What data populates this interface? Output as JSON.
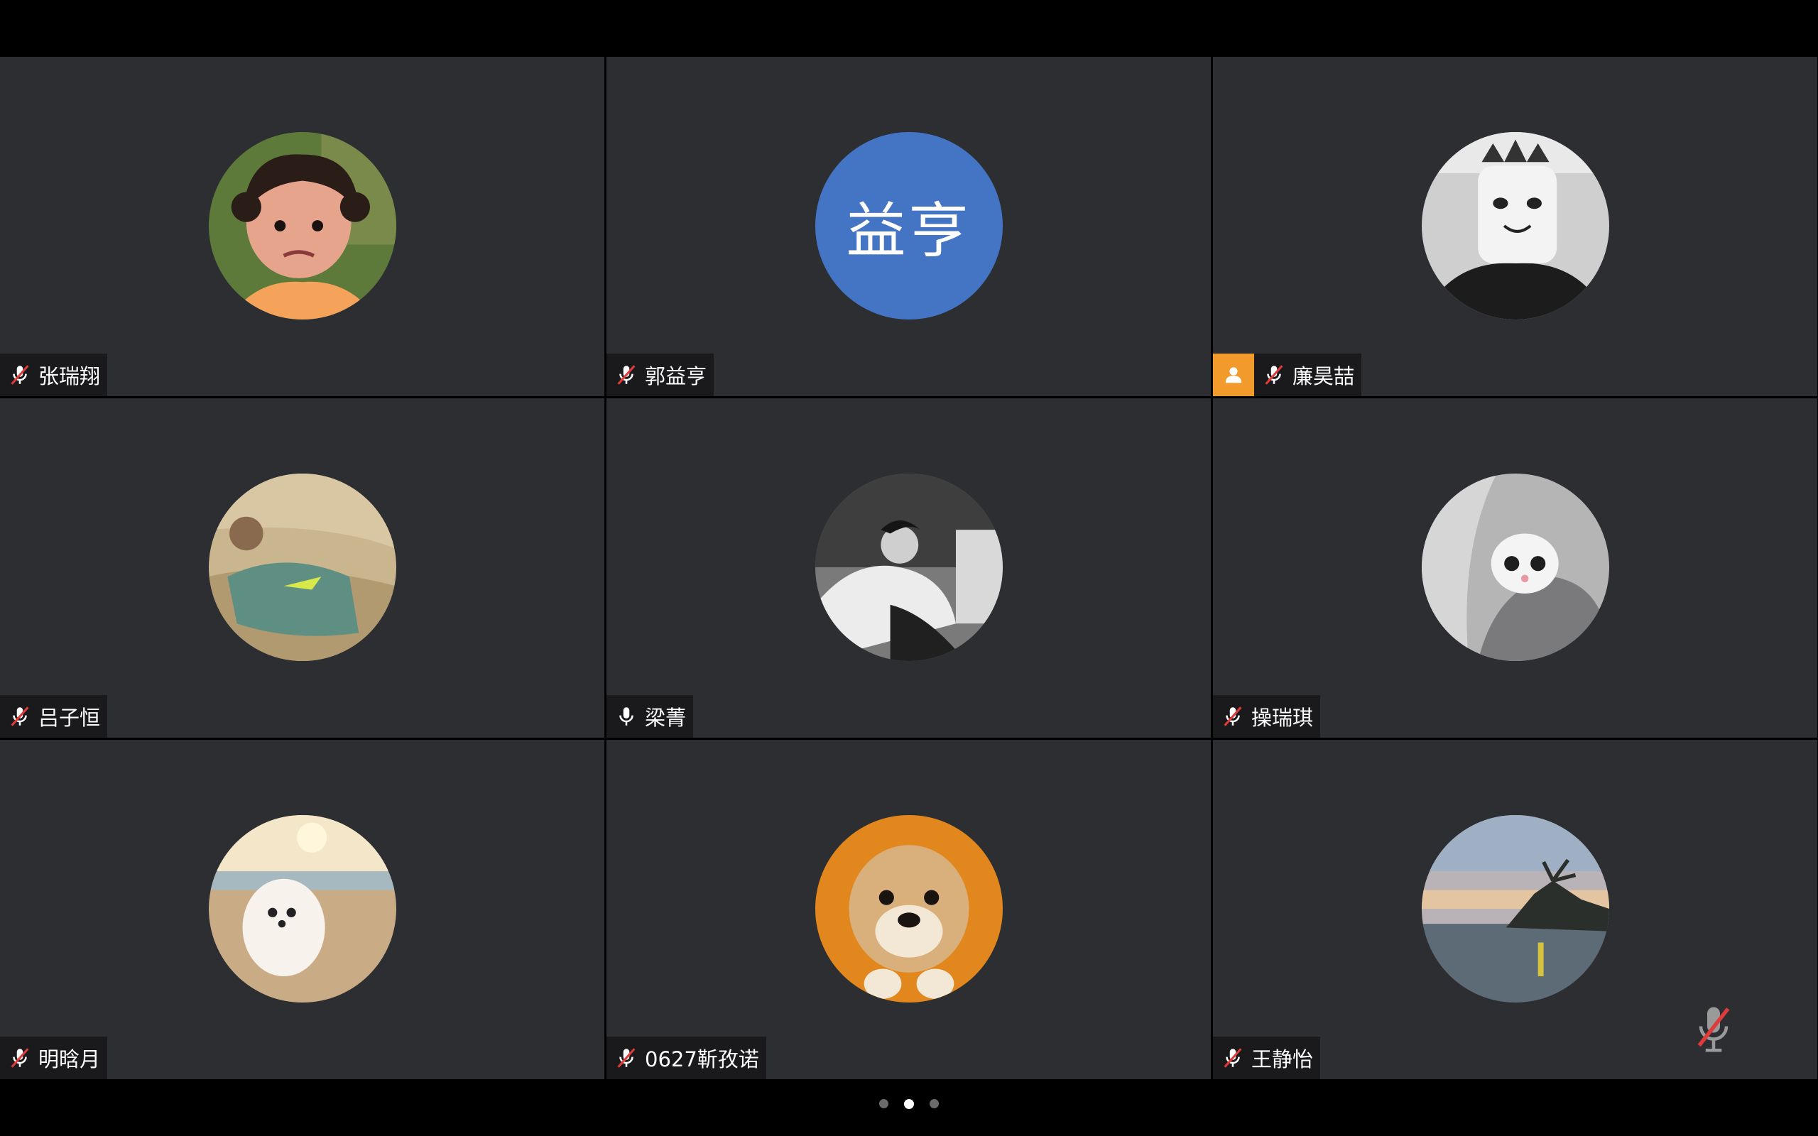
{
  "participants": [
    {
      "name": "张瑞翔",
      "muted": true,
      "avatar": "girl-photo-avatar"
    },
    {
      "name": "郭益亨",
      "muted": true,
      "avatar_text": "益亨"
    },
    {
      "name": "廉昊喆",
      "muted": true,
      "host": true,
      "avatar": "masked-person-avatar"
    },
    {
      "name": "吕子恒",
      "muted": true,
      "avatar": "reclining-man-avatar"
    },
    {
      "name": "梁菁",
      "muted": false,
      "avatar": "bw-portrait-avatar"
    },
    {
      "name": "操瑞琪",
      "muted": true,
      "avatar": "white-cat-avatar"
    },
    {
      "name": "明晗月",
      "muted": true,
      "avatar": "white-dog-beach-avatar"
    },
    {
      "name": "0627靳孜诺",
      "muted": true,
      "avatar": "shiba-puppy-avatar"
    },
    {
      "name": "王静怡",
      "muted": true,
      "avatar": "seaside-sunset-avatar"
    }
  ],
  "pagination": {
    "pages": 3,
    "current": 2
  },
  "colors": {
    "tile_bg": "#2c2e32",
    "initials_bg": "#4474c4",
    "host_badge": "#f39a2d",
    "mute_slash": "#e03b3b"
  }
}
